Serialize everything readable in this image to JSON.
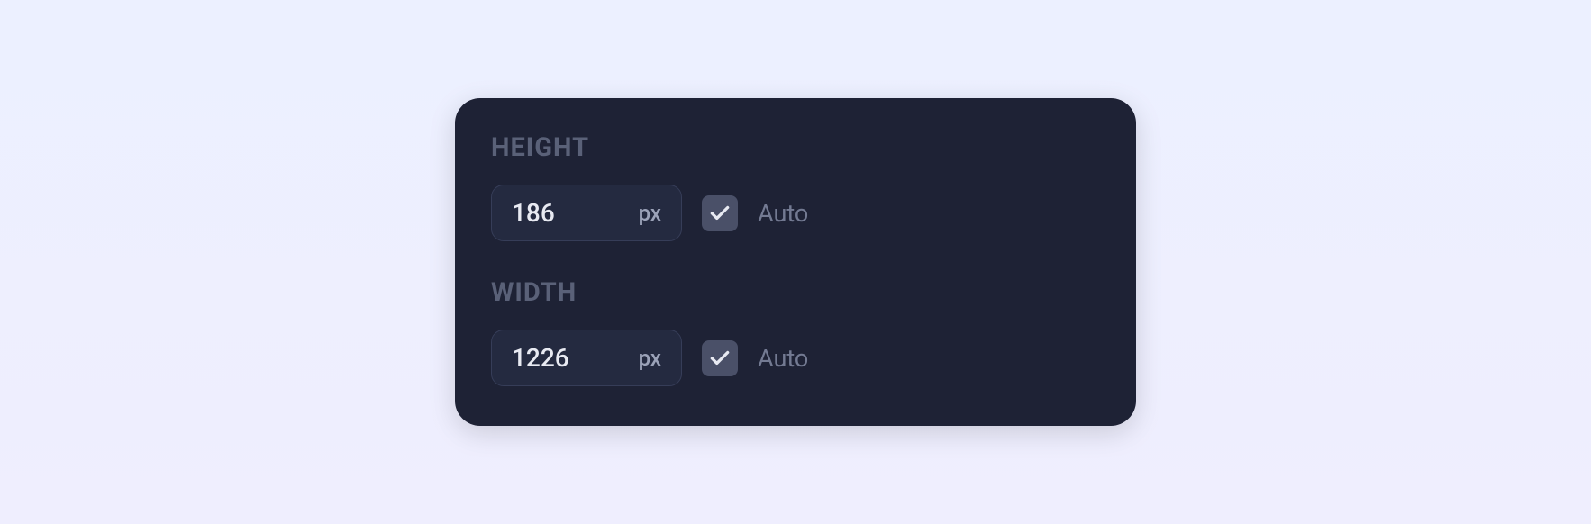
{
  "height": {
    "label": "HEIGHT",
    "value": "186",
    "unit": "px",
    "auto_label": "Auto",
    "auto_checked": true
  },
  "width": {
    "label": "WIDTH",
    "value": "1226",
    "unit": "px",
    "auto_label": "Auto",
    "auto_checked": true
  }
}
